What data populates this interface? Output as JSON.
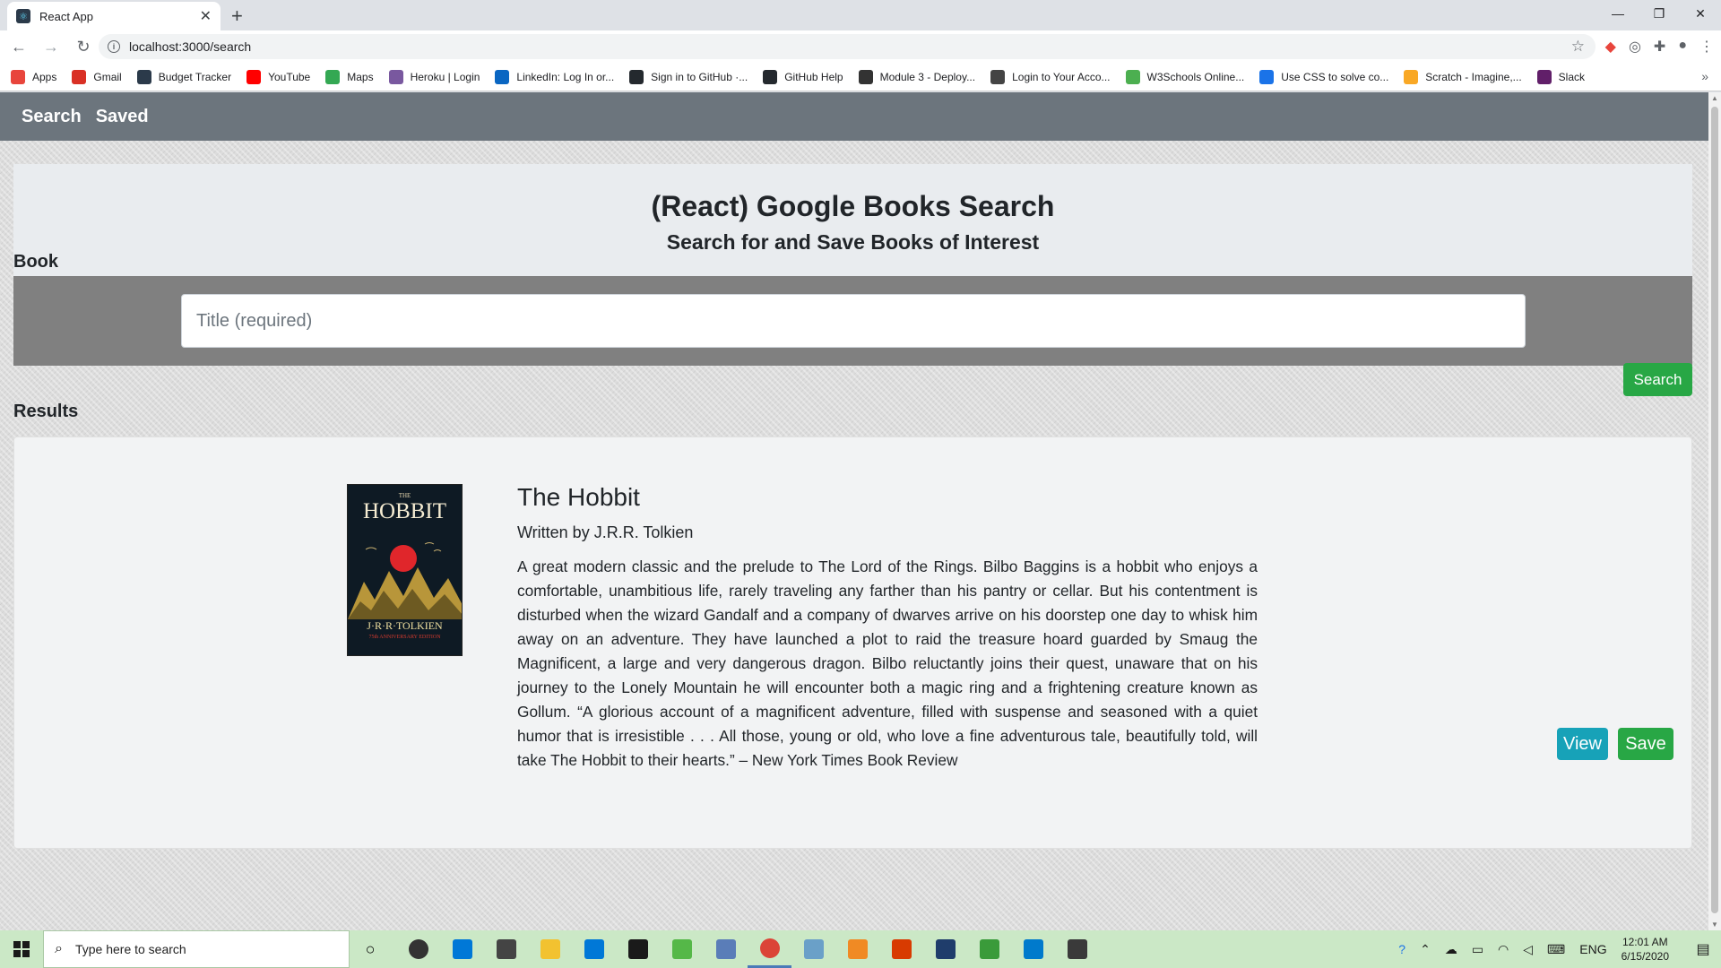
{
  "browser": {
    "tab_title": "React App",
    "url": "localhost:3000/search",
    "bookmarks": [
      {
        "label": "Apps",
        "color": "#e8453c"
      },
      {
        "label": "Gmail",
        "color": "#d93025"
      },
      {
        "label": "Budget Tracker",
        "color": "#2b3a4a"
      },
      {
        "label": "YouTube",
        "color": "#ff0000"
      },
      {
        "label": "Maps",
        "color": "#34a853"
      },
      {
        "label": "Heroku | Login",
        "color": "#79589f"
      },
      {
        "label": "LinkedIn: Log In or...",
        "color": "#0a66c2"
      },
      {
        "label": "Sign in to GitHub ·...",
        "color": "#24292e"
      },
      {
        "label": "GitHub Help",
        "color": "#24292e"
      },
      {
        "label": "Module 3 - Deploy...",
        "color": "#333333"
      },
      {
        "label": "Login to Your Acco...",
        "color": "#444444"
      },
      {
        "label": "W3Schools Online...",
        "color": "#4caf50"
      },
      {
        "label": "Use CSS to solve co...",
        "color": "#1a73e8"
      },
      {
        "label": "Scratch - Imagine,...",
        "color": "#f9a825"
      },
      {
        "label": "Slack",
        "color": "#611f69"
      }
    ]
  },
  "app": {
    "nav": {
      "search": "Search",
      "saved": "Saved"
    },
    "jumbotron": {
      "title": "(React) Google Books Search",
      "subtitle": "Search for and Save Books of Interest"
    },
    "form": {
      "label": "Book",
      "placeholder": "Title (required)",
      "value": "",
      "button": "Search"
    },
    "results": {
      "label": "Results",
      "items": [
        {
          "title": "The Hobbit",
          "author": "Written by J.R.R. Tolkien",
          "cover": {
            "the": "THE",
            "title": "HOBBIT",
            "author": "J·R·R·TOLKIEN",
            "edition": "75th ANNIVERSARY EDITION"
          },
          "description": "A great modern classic and the prelude to The Lord of the Rings. Bilbo Baggins is a hobbit who enjoys a comfortable, unambitious life, rarely traveling any farther than his pantry or cellar. But his contentment is disturbed when the wizard Gandalf and a company of dwarves arrive on his doorstep one day to whisk him away on an adventure. They have launched a plot to raid the treasure hoard guarded by Smaug the Magnificent, a large and very dangerous dragon. Bilbo reluctantly joins their quest, unaware that on his journey to the Lonely Mountain he will encounter both a magic ring and a frightening creature known as Gollum. “A glorious account of a magnificent adventure, filled with suspense and seasoned with a quiet humor that is irresistible . . . All those, young or old, who love a fine adventurous tale, beautifully told, will take The Hobbit to their hearts.” – New York Times Book Review",
          "view_label": "View",
          "save_label": "Save"
        }
      ]
    }
  },
  "taskbar": {
    "search_placeholder": "Type here to search",
    "language": "ENG",
    "time": "12:01 AM",
    "date": "6/15/2020",
    "apps": [
      {
        "name": "task-view",
        "color": "#333333"
      },
      {
        "name": "edge",
        "color": "#0078d7"
      },
      {
        "name": "store",
        "color": "#444444"
      },
      {
        "name": "file-explorer",
        "color": "#f2c230"
      },
      {
        "name": "mail",
        "color": "#0078d7"
      },
      {
        "name": "dropbox",
        "color": "#1a1a1a"
      },
      {
        "name": "app-green",
        "color": "#55b848"
      },
      {
        "name": "app-printer",
        "color": "#5a7db8"
      },
      {
        "name": "chrome",
        "color": "#db4437"
      },
      {
        "name": "app-blue-pen",
        "color": "#6aa0c8"
      },
      {
        "name": "app-media",
        "color": "#f08a24"
      },
      {
        "name": "office",
        "color": "#d83b01"
      },
      {
        "name": "app-dark-blue",
        "color": "#1f3d6b"
      },
      {
        "name": "app-green-tree",
        "color": "#3a9b3a"
      },
      {
        "name": "vscode",
        "color": "#007acc"
      },
      {
        "name": "sticky-notes",
        "color": "#3a3a3a"
      }
    ]
  }
}
